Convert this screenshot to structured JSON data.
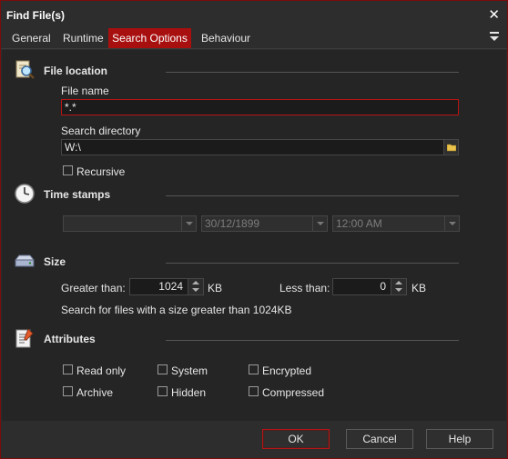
{
  "window": {
    "title": "Find File(s)"
  },
  "tabs": [
    {
      "label": "General"
    },
    {
      "label": "Runtime"
    },
    {
      "label": "Search Options"
    },
    {
      "label": "Behaviour"
    }
  ],
  "file_location": {
    "title": "File location",
    "file_name_label": "File name",
    "file_name_value": "*.*",
    "search_directory_label": "Search directory",
    "search_directory_value": "W:\\",
    "recursive_label": "Recursive"
  },
  "time_stamps": {
    "title": "Time stamps",
    "mode_value": "",
    "date_value": "30/12/1899",
    "time_value": "12:00 AM"
  },
  "size": {
    "title": "Size",
    "greater_label": "Greater than:",
    "greater_value": "1024",
    "greater_unit": "KB",
    "less_label": "Less than:",
    "less_value": "0",
    "less_unit": "KB",
    "summary": "Search for files with a size greater than 1024KB"
  },
  "attributes": {
    "title": "Attributes",
    "read_only": "Read only",
    "system": "System",
    "encrypted": "Encrypted",
    "archive": "Archive",
    "hidden": "Hidden",
    "compressed": "Compressed"
  },
  "footer": {
    "ok": "OK",
    "cancel": "Cancel",
    "help": "Help"
  },
  "colors": {
    "accent": "#a80f0f",
    "background": "#252526",
    "chrome": "#2d2d2d"
  },
  "icons": [
    "close-icon",
    "menu-icon",
    "file-search-icon",
    "clock-icon",
    "drive-icon",
    "attributes-icon",
    "folder-icon"
  ]
}
